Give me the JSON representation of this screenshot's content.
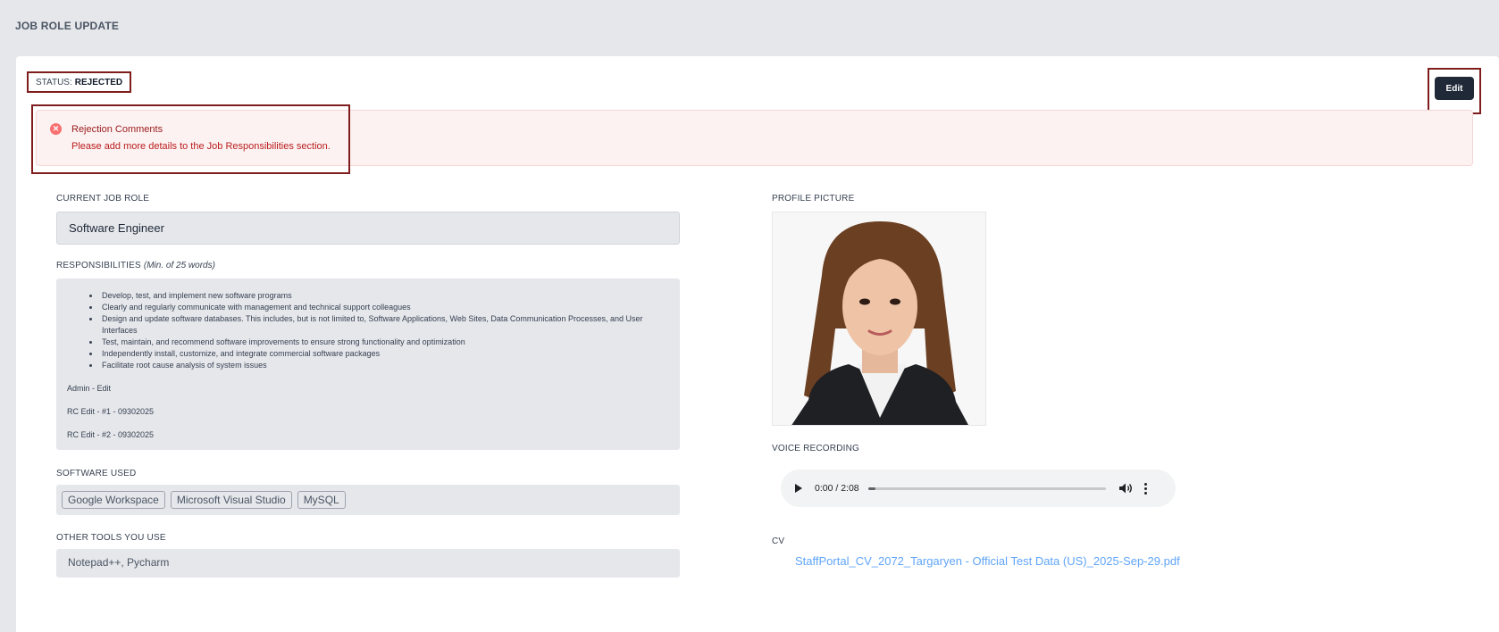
{
  "page": {
    "title": "JOB ROLE UPDATE"
  },
  "status": {
    "prefix": "STATUS:",
    "value": "REJECTED"
  },
  "actions": {
    "edit_label": "Edit"
  },
  "rejection": {
    "title": "Rejection Comments",
    "message": "Please add more details to the Job Responsibilities section.",
    "icon": "x-circle-icon",
    "color": "#b91c1c"
  },
  "current_job_role": {
    "label": "CURRENT JOB ROLE",
    "value": "Software Engineer"
  },
  "responsibilities": {
    "label": "RESPONSIBILITIES",
    "hint": "(Min. of 25 words)",
    "items": [
      "Develop, test, and implement new software programs",
      "Clearly and regularly communicate with management and technical support colleagues",
      "Design and update software databases. This includes, but is not limited to, Software Applications, Web Sites, Data Communication Processes, and User Interfaces",
      "Test, maintain, and recommend software improvements to ensure strong functionality and optimization",
      "Independently install, customize, and integrate commercial software packages",
      "Facilitate root cause analysis of system issues"
    ],
    "notes": [
      "Admin - Edit",
      "RC Edit - #1 - 09302025",
      "RC Edit - #2 - 09302025"
    ]
  },
  "software_used": {
    "label": "SOFTWARE USED",
    "items": [
      "Google Workspace",
      "Microsoft Visual Studio",
      "MySQL"
    ]
  },
  "other_tools": {
    "label": "OTHER TOOLS YOU USE",
    "value": "Notepad++, Pycharm"
  },
  "profile_picture": {
    "label": "PROFILE PICTURE"
  },
  "voice_recording": {
    "label": "VOICE RECORDING",
    "time": "0:00 / 2:08",
    "progress": 0.0
  },
  "cv": {
    "label": "CV",
    "file": "StaffPortal_CV_2072_Targaryen - Official Test Data (US)_2025-Sep-29.pdf"
  }
}
